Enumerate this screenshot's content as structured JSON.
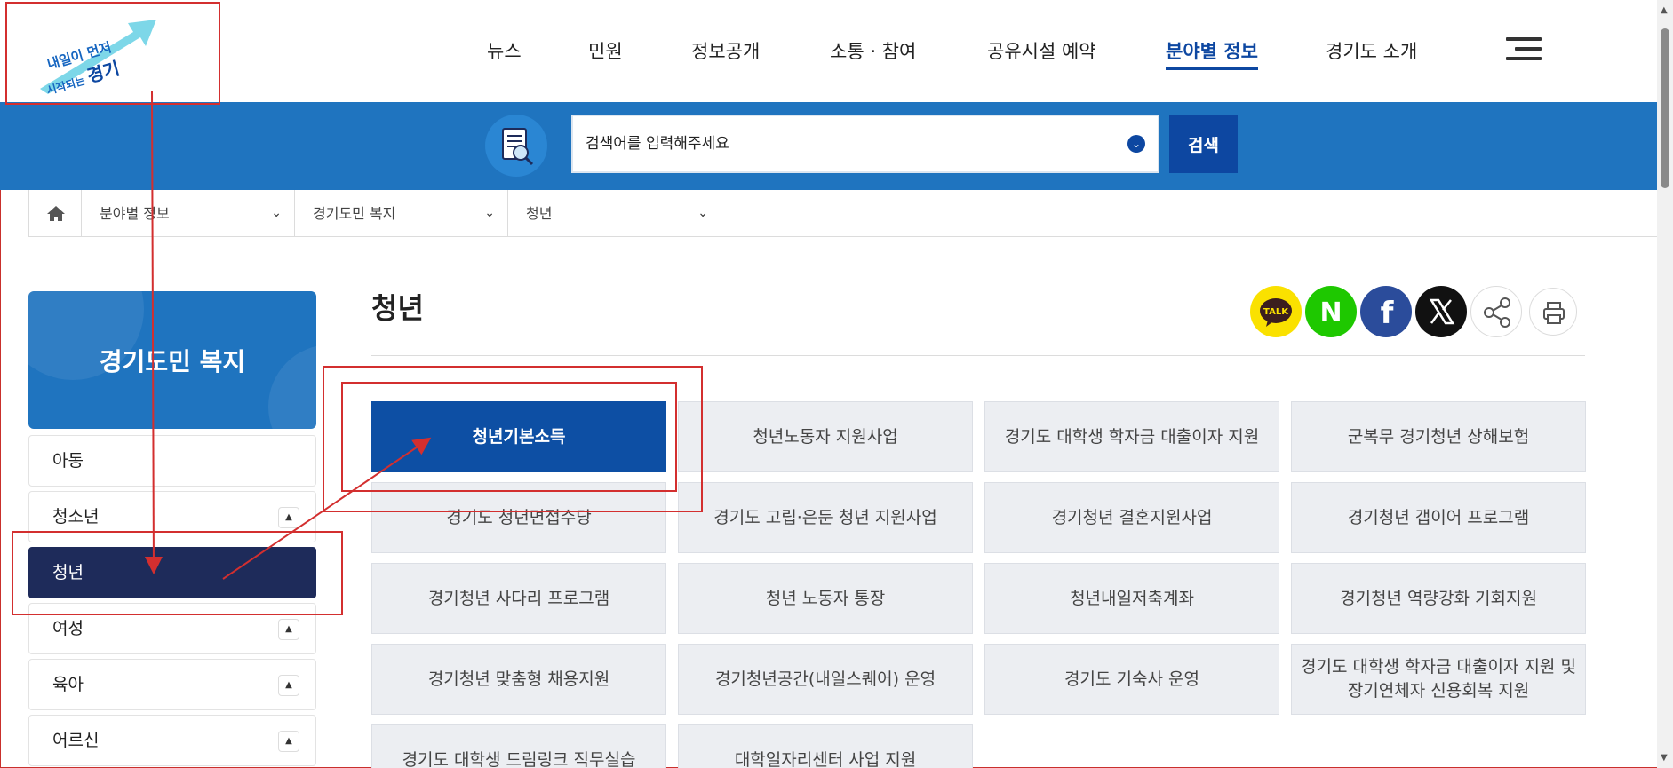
{
  "header": {
    "logo_line1": "내일이 먼저",
    "logo_line2": "시작되는",
    "logo_line2_bold": "경기",
    "nav": [
      "뉴스",
      "민원",
      "정보공개",
      "소통 · 참여",
      "공유시설 예약",
      "분야별 정보",
      "경기도 소개"
    ],
    "active_nav": "분야별 정보"
  },
  "search": {
    "placeholder": "검색어를 입력해주세요",
    "button_label": "검색"
  },
  "breadcrumb": {
    "items": [
      "분야별 정보",
      "경기도민 복지",
      "청년"
    ]
  },
  "sidebar": {
    "title": "경기도민 복지",
    "items": [
      {
        "label": "아동",
        "has_toggle": false
      },
      {
        "label": "청소년",
        "has_toggle": true
      },
      {
        "label": "청년",
        "has_toggle": false,
        "active": true
      },
      {
        "label": "여성",
        "has_toggle": true
      },
      {
        "label": "육아",
        "has_toggle": true
      },
      {
        "label": "어르신",
        "has_toggle": true
      }
    ]
  },
  "main": {
    "title": "청년",
    "share_labels": {
      "kakao": "TALK",
      "naver": "N",
      "facebook": "f",
      "x": "𝕏"
    },
    "programs": [
      "청년기본소득",
      "청년노동자 지원사업",
      "경기도 대학생 학자금 대출이자 지원",
      "군복무 경기청년 상해보험",
      "경기도 청년면접수당",
      "경기도 고립·은둔 청년 지원사업",
      "경기청년 결혼지원사업",
      "경기청년 갭이어 프로그램",
      "경기청년 사다리 프로그램",
      "청년 노동자 통장",
      "청년내일저축계좌",
      "경기청년 역량강화 기회지원",
      "경기청년 맞춤형 채용지원",
      "경기청년공간(내일스퀘어) 운영",
      "경기도 기숙사 운영",
      "경기도 대학생 학자금 대출이자 지원 및 장기연체자 신용회복 지원",
      "경기도 대학생 드림링크 직무실습",
      "대학일자리센터 사업 지원"
    ],
    "active_program": "청년기본소득"
  },
  "colors": {
    "brand_blue": "#1f74bf",
    "dark_navy": "#1e2b5a",
    "active_button": "#0d4fa4",
    "annotation_red": "#d32f2f"
  }
}
